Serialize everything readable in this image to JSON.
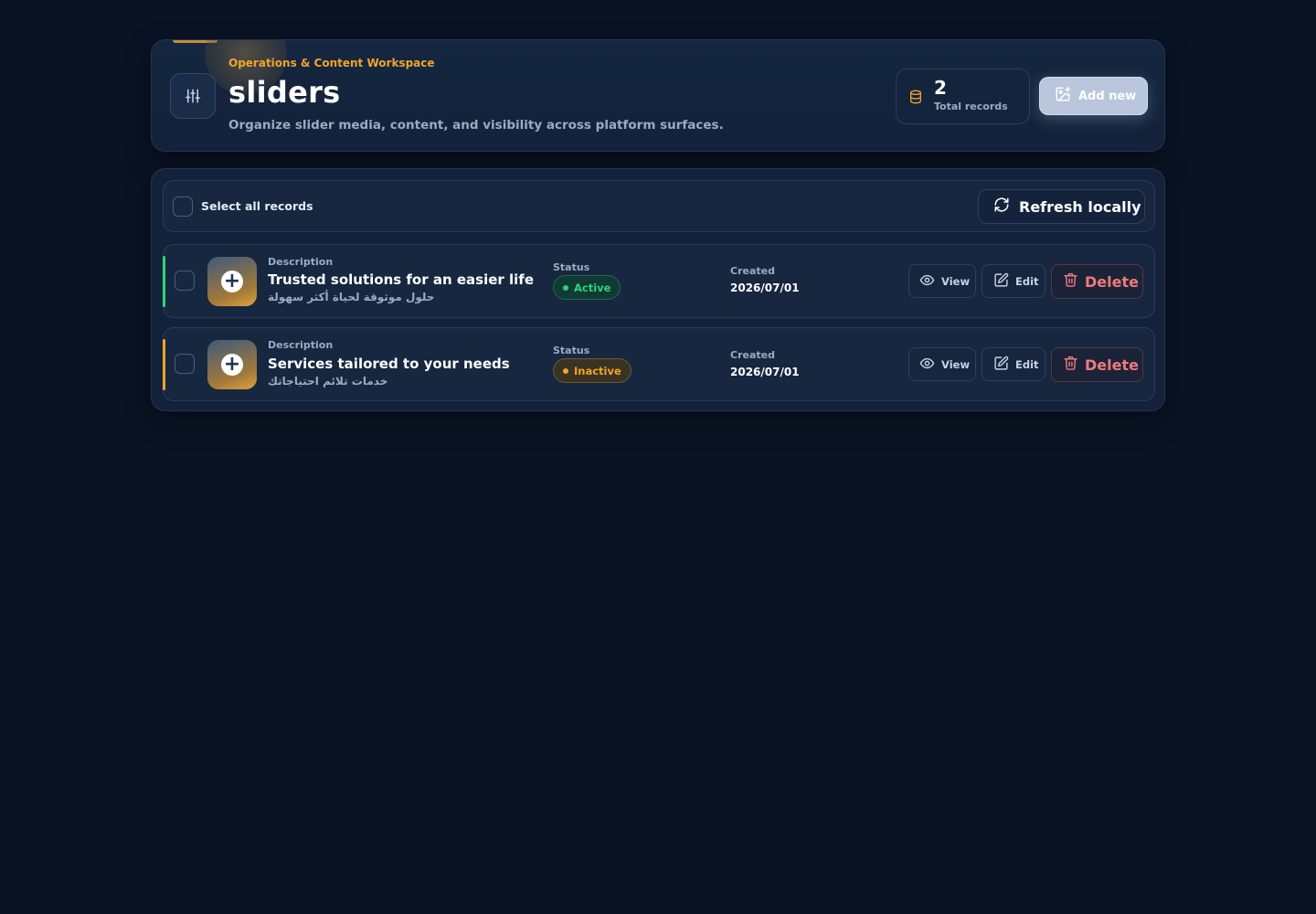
{
  "header": {
    "eyebrow": "Operations & Content Workspace",
    "title": "sliders",
    "subtitle": "Organize slider media, content, and visibility across platform surfaces.",
    "stat": {
      "count": "2",
      "label": "Total records"
    },
    "add_button_label": "Add new"
  },
  "toolbar": {
    "select_all_label": "Select all records",
    "refresh_label": "Refresh locally"
  },
  "columns": {
    "description": "Description",
    "status": "Status",
    "created": "Created"
  },
  "actions": {
    "view": "View",
    "edit": "Edit",
    "delete": "Delete"
  },
  "rows": [
    {
      "title": "Trusted solutions for an easier life",
      "title_ar": "حلول موثوقة لحياة أكثر سهولة",
      "status": "Active",
      "created": "2026/07/01"
    },
    {
      "title": "Services tailored to your needs",
      "title_ar": "خدمات تلائم احتياجاتك",
      "status": "Inactive",
      "created": "2026/07/01"
    }
  ],
  "colors": {
    "background": "#0a1324",
    "accent_orange": "#f0a429",
    "active_green": "#2ed47a",
    "delete_red": "#f07a7a"
  },
  "icons": {
    "header": "sliders-icon",
    "stat": "database-icon",
    "add": "image-plus-icon",
    "refresh": "refresh-icon",
    "thumb": "plus-circle-icon",
    "view": "eye-icon",
    "edit": "pencil-icon",
    "delete": "trash-icon"
  }
}
